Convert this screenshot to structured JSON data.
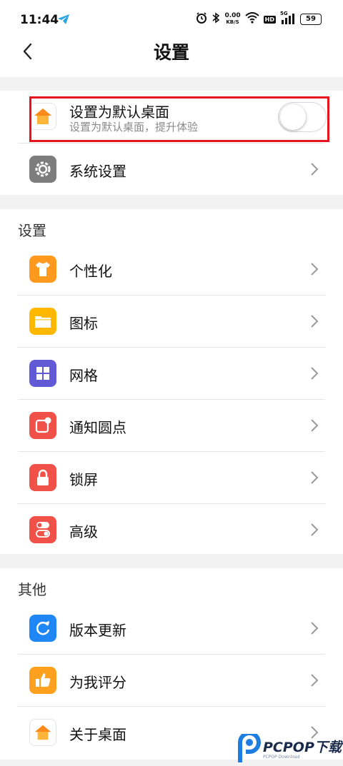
{
  "status_bar": {
    "time": "11:44",
    "net_speed_value": "0.00",
    "net_speed_unit": "KB/S",
    "hd_label": "HD",
    "signal_label": "5G",
    "battery": "59"
  },
  "header": {
    "title": "设置"
  },
  "default_launcher": {
    "title": "设置为默认桌面",
    "subtitle": "设置为默认桌面，提升体验",
    "toggle_on": false
  },
  "top_items": [
    {
      "label": "系统设置",
      "icon": "gear-icon",
      "color": "#7d7d7d"
    }
  ],
  "sections": [
    {
      "title": "设置",
      "items": [
        {
          "label": "个性化",
          "icon": "shirt-icon",
          "color": "#ff9a1f"
        },
        {
          "label": "图标",
          "icon": "folder-icon",
          "color": "#ffb700"
        },
        {
          "label": "网格",
          "icon": "grid-icon",
          "color": "#6159d6"
        },
        {
          "label": "通知圆点",
          "icon": "notification-dot-icon",
          "color": "#f0524a"
        },
        {
          "label": "锁屏",
          "icon": "lock-icon",
          "color": "#f0524a"
        },
        {
          "label": "高级",
          "icon": "toggles-icon",
          "color": "#f0524a"
        }
      ]
    },
    {
      "title": "其他",
      "items": [
        {
          "label": "版本更新",
          "icon": "refresh-icon",
          "color": "#1f86f5"
        },
        {
          "label": "为我评分",
          "icon": "thumbs-up-icon",
          "color": "#ffa01f"
        },
        {
          "label": "关于桌面",
          "icon": "home-icon",
          "color": "#ffffff"
        }
      ]
    }
  ],
  "watermark": {
    "brand": "PCPOP下载",
    "sub": "PCPOP Download"
  }
}
